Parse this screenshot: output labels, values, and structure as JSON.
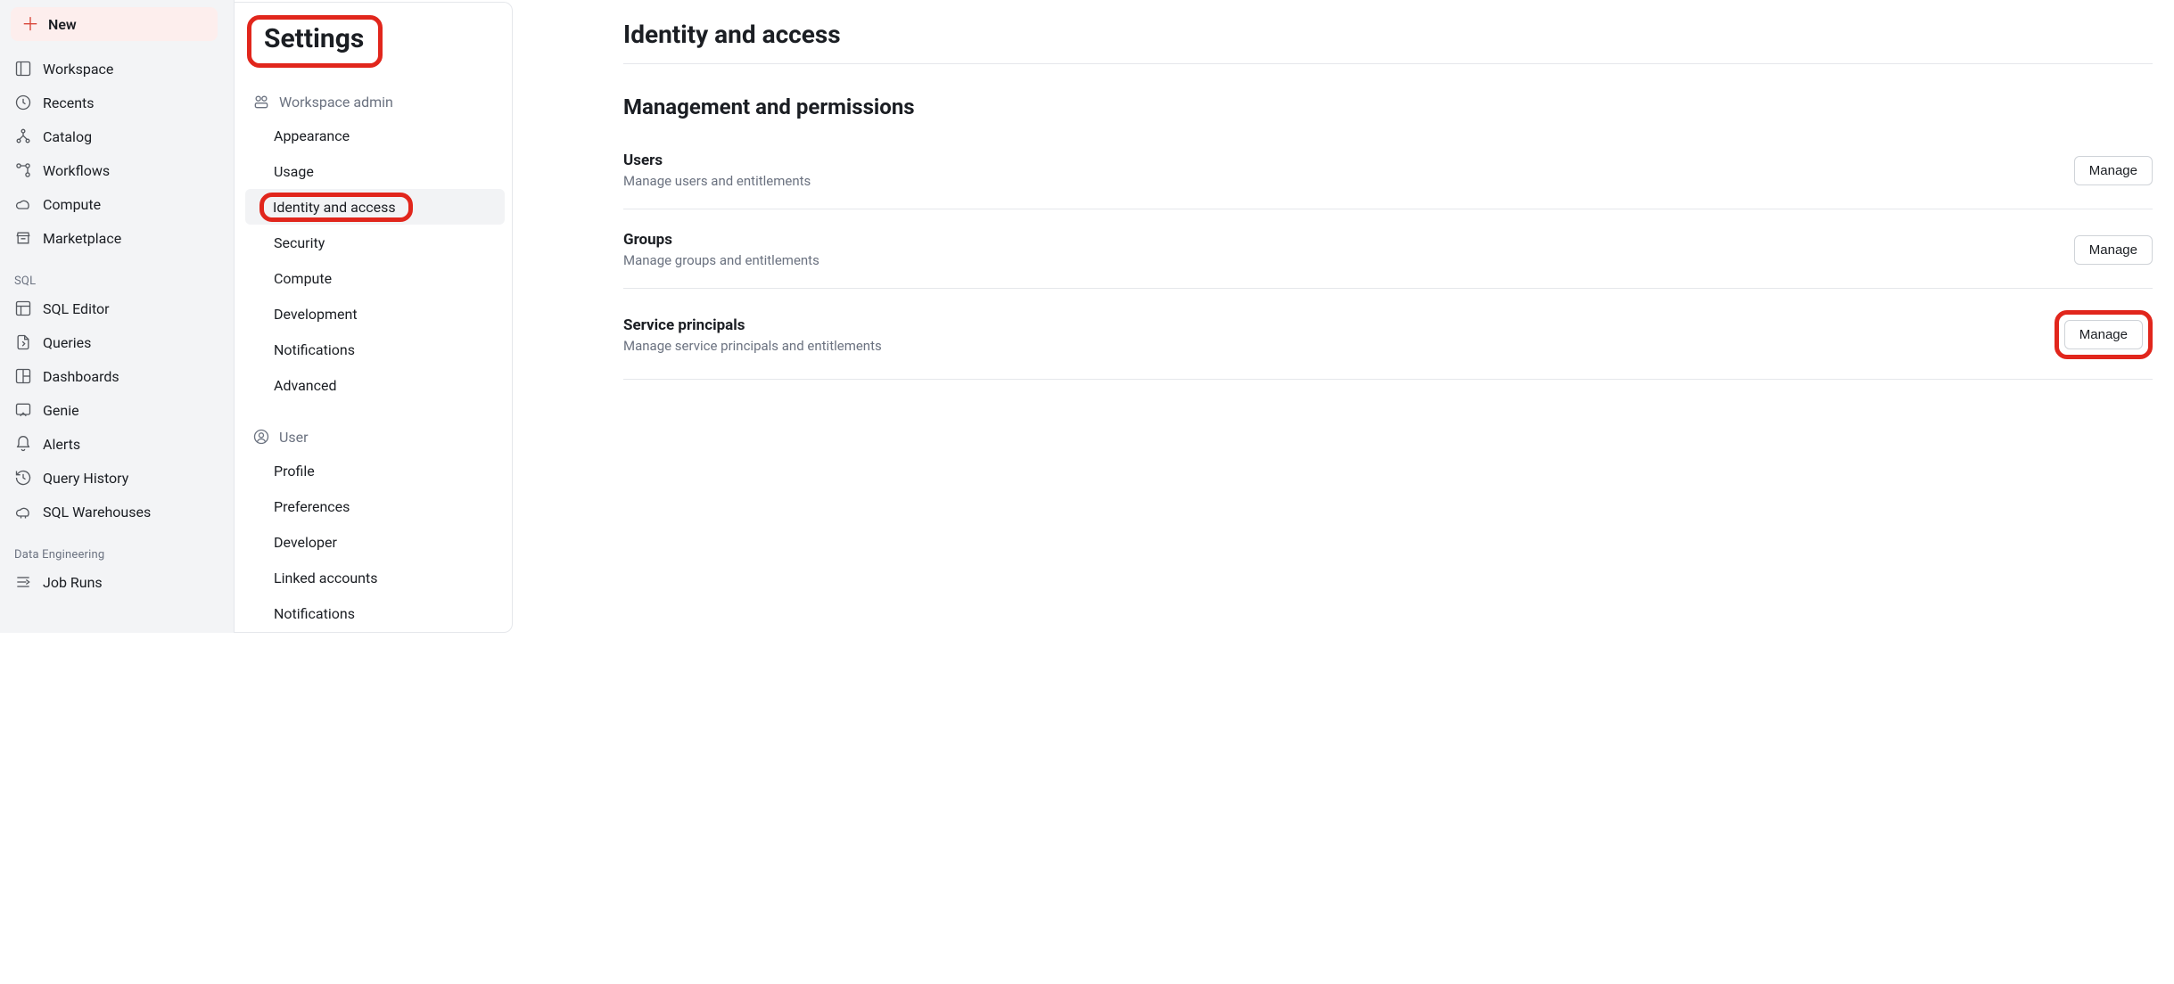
{
  "nav": {
    "new_label": "New",
    "primary": [
      {
        "label": "Workspace",
        "icon": "panel-icon"
      },
      {
        "label": "Recents",
        "icon": "clock-icon"
      },
      {
        "label": "Catalog",
        "icon": "hierarchy-icon"
      },
      {
        "label": "Workflows",
        "icon": "workflow-icon"
      },
      {
        "label": "Compute",
        "icon": "cloud-icon"
      },
      {
        "label": "Marketplace",
        "icon": "store-icon"
      }
    ],
    "groups": [
      {
        "label": "SQL",
        "items": [
          {
            "label": "SQL Editor",
            "icon": "sql-icon"
          },
          {
            "label": "Queries",
            "icon": "query-icon"
          },
          {
            "label": "Dashboards",
            "icon": "dashboard-icon"
          },
          {
            "label": "Genie",
            "icon": "genie-icon"
          },
          {
            "label": "Alerts",
            "icon": "bell-icon"
          },
          {
            "label": "Query History",
            "icon": "history-icon"
          },
          {
            "label": "SQL Warehouses",
            "icon": "warehouse-icon"
          }
        ]
      },
      {
        "label": "Data Engineering",
        "items": [
          {
            "label": "Job Runs",
            "icon": "jobruns-icon"
          }
        ]
      }
    ]
  },
  "settings": {
    "title": "Settings",
    "groups": [
      {
        "label": "Workspace admin",
        "icon": "admin-icon",
        "items": [
          {
            "label": "Appearance",
            "selected": false
          },
          {
            "label": "Usage",
            "selected": false
          },
          {
            "label": "Identity and access",
            "selected": true,
            "highlight": true
          },
          {
            "label": "Security",
            "selected": false
          },
          {
            "label": "Compute",
            "selected": false
          },
          {
            "label": "Development",
            "selected": false
          },
          {
            "label": "Notifications",
            "selected": false
          },
          {
            "label": "Advanced",
            "selected": false
          }
        ]
      },
      {
        "label": "User",
        "icon": "user-icon",
        "items": [
          {
            "label": "Profile"
          },
          {
            "label": "Preferences"
          },
          {
            "label": "Developer"
          },
          {
            "label": "Linked accounts"
          },
          {
            "label": "Notifications"
          }
        ]
      }
    ]
  },
  "main": {
    "title": "Identity and access",
    "section_title": "Management and permissions",
    "rows": [
      {
        "title": "Users",
        "desc": "Manage users and entitlements",
        "action": "Manage",
        "highlight": false
      },
      {
        "title": "Groups",
        "desc": "Manage groups and entitlements",
        "action": "Manage",
        "highlight": false
      },
      {
        "title": "Service principals",
        "desc": "Manage service principals and entitlements",
        "action": "Manage",
        "highlight": true
      }
    ]
  },
  "annotations": {
    "highlight_color": "#e1261c"
  }
}
